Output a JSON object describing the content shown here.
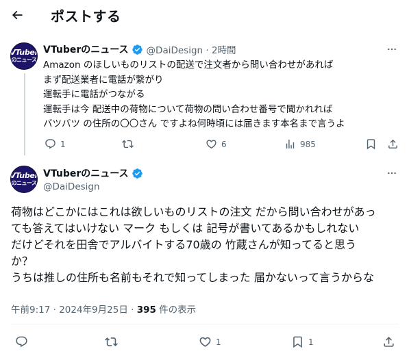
{
  "header": {
    "back_icon": "arrow-left-icon",
    "title": "ポストする"
  },
  "avatar": {
    "line1": "VTuber",
    "line2": "のニュース"
  },
  "reply": {
    "author_name": "VTuberのニュース",
    "handle_time": "@DaiDesign · 2時間",
    "lines": [
      "Amazon のほしいものリストの配送で注文者から問い合わせがあれば",
      "まず配送業者に電話が繋がり",
      "運転手に電話がつながる",
      "運転手は今 配送中の荷物について荷物の問い合わせ番号で聞かれれば",
      "バツバツ の住所の〇〇さん ですよね何時頃には届きます本名まで言うよ"
    ],
    "actions": {
      "reply_count": "1",
      "repost_count": "",
      "like_count": "6",
      "view_count": "985"
    }
  },
  "main_post": {
    "author_name": "VTuberのニュース",
    "handle": "@DaiDesign",
    "lines": [
      "荷物はどこかにはこれは欲しいものリストの注文 だから問い合わせがあっ",
      "ても答えてはいけない マーク もしくは 記号が書いてあるかもしれない",
      "だけどそれを田舎でアルバイトする70歳の 竹蔵さんが知ってると思う",
      "か？",
      "うちは推しの住所も名前もそれで知ってしまった 届かないって言うからな"
    ],
    "timestamp": "午前9:17 · 2024年9月25日 · ",
    "views_count": "395",
    "views_label": " 件の表示",
    "actions": {
      "reply_count": "",
      "repost_count": "",
      "like_count": "1",
      "bookmark_count": "1"
    }
  },
  "colors": {
    "text": "#0f1419",
    "secondary": "#536471",
    "verified": "#1d9bf0",
    "avatar_bg": "#1c1466",
    "divider": "#eff3f4"
  }
}
